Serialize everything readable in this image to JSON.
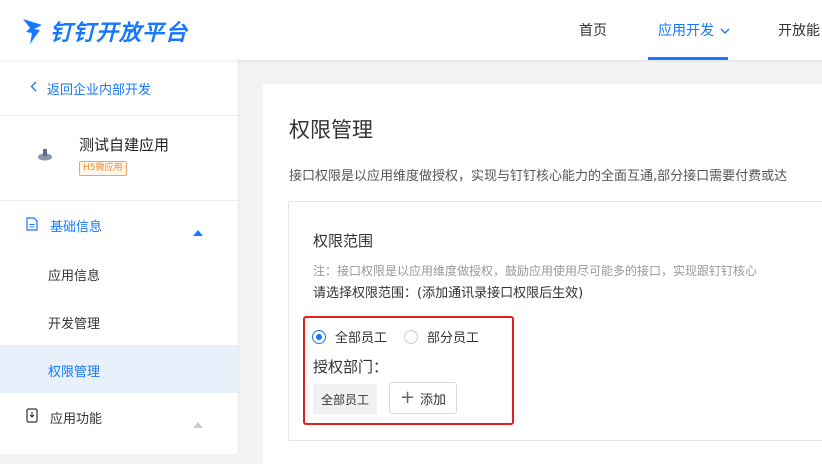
{
  "header": {
    "brand": "钉钉开放平台",
    "nav": {
      "home": "首页",
      "dev": "应用开发",
      "capability": "开放能"
    }
  },
  "sidebar": {
    "back": "返回企业内部开发",
    "app": {
      "name": "测试自建应用",
      "badge": "H5微应用"
    },
    "section_basic": "基础信息",
    "items": [
      {
        "label": "应用信息"
      },
      {
        "label": "开发管理"
      },
      {
        "label": "权限管理"
      }
    ],
    "section_func": "应用功能"
  },
  "main": {
    "title": "权限管理",
    "description": "接口权限是以应用维度做授权，实现与钉钉核心能力的全面互通,部分接口需要付费或达",
    "card": {
      "title": "权限范围",
      "note": "注：接口权限是以应用维度做授权，鼓励应用使用尽可能多的接口，实现跟钉钉核心",
      "note_bold": "请选择权限范围：(添加通讯录接口权限后生效)",
      "radio_all": "全部员工",
      "radio_partial": "部分员工",
      "auth_label": "授权部门：",
      "tag": "全部员工",
      "add": "添加"
    }
  },
  "colors": {
    "accent": "#1677ff",
    "highlight": "#e02020"
  }
}
